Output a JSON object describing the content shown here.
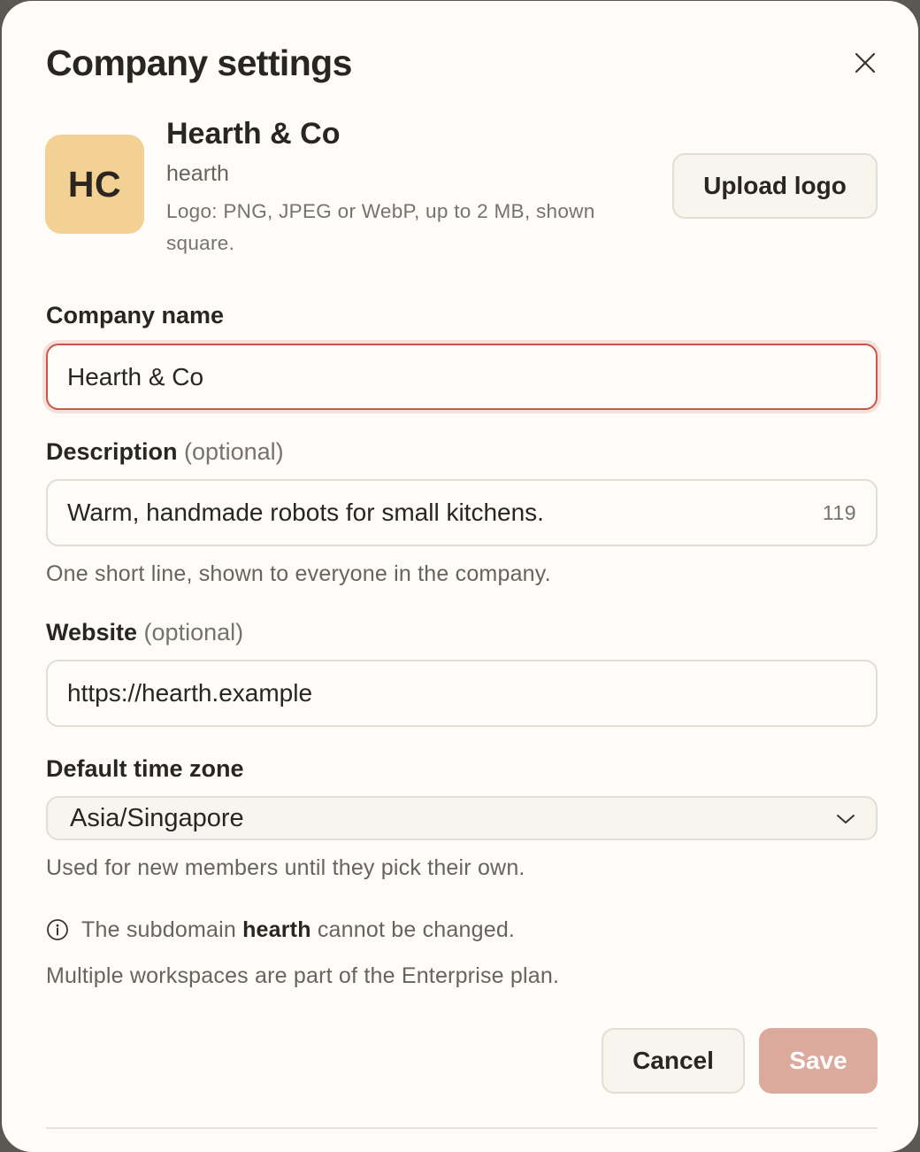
{
  "dialog": {
    "title": "Company settings",
    "close_icon": "close-icon"
  },
  "company": {
    "avatar_initials": "HC",
    "avatar_color": "#f3d094",
    "name": "Hearth & Co",
    "slug": "hearth",
    "logo_hint": "Logo: PNG, JPEG or WebP, up to 2 MB, shown square.",
    "upload_label": "Upload logo"
  },
  "form": {
    "company_name": {
      "label": "Company name",
      "value": "Hearth & Co",
      "state": "focused"
    },
    "description": {
      "label": "Description",
      "optional": "(optional)",
      "value": "Warm, handmade robots for small kitchens.",
      "remaining": "119",
      "hint": "One short line, shown to everyone in the company."
    },
    "website": {
      "label": "Website",
      "optional": "(optional)",
      "value": "https://hearth.example"
    },
    "timezone": {
      "label": "Default time zone",
      "value": "Asia/Singapore",
      "hint": "Used for new members until they pick their own."
    }
  },
  "notice": {
    "icon": "info-icon",
    "prefix": "The subdomain ",
    "subdomain": "hearth",
    "suffix": " cannot be changed."
  },
  "plan_note": "Multiple workspaces are part of the Enterprise plan.",
  "actions": {
    "cancel": "Cancel",
    "save": "Save",
    "save_disabled": true
  },
  "colors": {
    "accent": "#c6594b",
    "save_bg": "#dca99d",
    "background": "#fdfcf8"
  }
}
